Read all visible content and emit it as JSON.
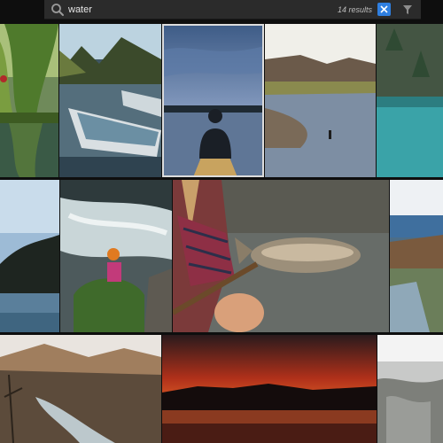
{
  "search": {
    "value": "water",
    "placeholder": ""
  },
  "results_label": "14 results",
  "colors": {
    "accent": "#2f7fe0",
    "bar": "#2b2b2b",
    "background": "#0e0e0e"
  },
  "icons": {
    "search": "search-icon",
    "clear": "close-icon",
    "filter": "filter-icon"
  },
  "gallery": {
    "photos": [
      "willow-tree-reflection",
      "rowboats-on-lake",
      "kayaker-at-dusk",
      "angler-in-river-valley",
      "turquoise-mountain-lake",
      "dark-hill-and-lake",
      "hiker-by-rapids",
      "angler-holding-trout",
      "coastal-cliffs",
      "canyon-creek",
      "red-sunset-over-lake",
      "misty-hillside"
    ],
    "selected": "kayaker-at-dusk"
  }
}
